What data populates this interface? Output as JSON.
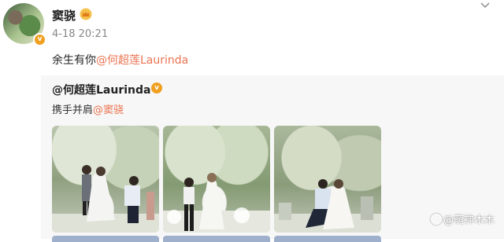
{
  "post": {
    "username": "窦骁",
    "timestamp": "4-18 20:21",
    "text_prefix": "余生有你",
    "text_mention": "@何超莲Laurinda",
    "icons": {
      "avatar": "avatar",
      "verified": "verified-badge-icon",
      "crown": "crown-icon",
      "more": "chevron-down-icon"
    }
  },
  "repost": {
    "username": "@何超莲Laurinda",
    "text_prefix": "携手并肩",
    "text_mention": "@窦骁",
    "photos": [
      {
        "name": "wedding-photo-1"
      },
      {
        "name": "wedding-photo-2"
      },
      {
        "name": "wedding-photo-3"
      }
    ]
  },
  "watermark": "@萌神木木",
  "colors": {
    "mention": "#eb7350",
    "badge": "#f0a020",
    "repost_bg": "#f7f7f7"
  }
}
